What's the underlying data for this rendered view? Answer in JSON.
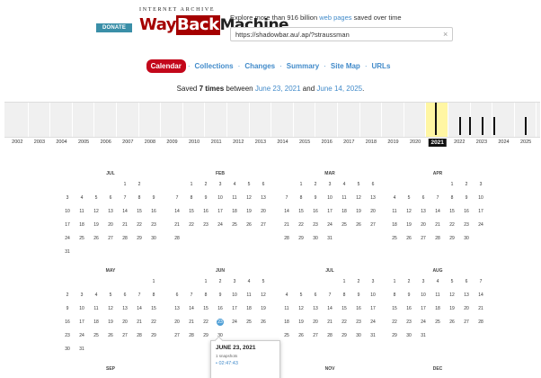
{
  "header": {
    "donate_label": "DONATE",
    "logo_top": "INTERNET ARCHIVE",
    "logo_way": "Way",
    "logo_back": "Back",
    "logo_machine": "Machine",
    "tagline_pre": "Explore more than 916 billion ",
    "tagline_link": "web pages",
    "tagline_post": " saved over time",
    "url_value": "https://shadowbar.au/.ap/?straussman",
    "clear_icon": "close-icon"
  },
  "nav": {
    "calendar": "Calendar",
    "collections": "Collections",
    "changes": "Changes",
    "summary": "Summary",
    "sitemap": "Site Map",
    "urls": "URLs"
  },
  "summary": {
    "pre": "Saved ",
    "count": "7 times",
    "mid": " between ",
    "start": "June 23, 2021",
    "and": " and ",
    "end": "June 14, 2025",
    "post": "."
  },
  "timeline": {
    "selected_year": "2021",
    "years": [
      "2002",
      "2003",
      "2004",
      "2005",
      "2006",
      "2007",
      "2008",
      "2009",
      "2010",
      "2011",
      "2012",
      "2013",
      "2014",
      "2015",
      "2016",
      "2017",
      "2018",
      "2019",
      "2020",
      "2021",
      "2022",
      "2023",
      "2024",
      "2025"
    ]
  },
  "calendar": {
    "months": [
      {
        "name": "JUL",
        "days": [
          "",
          "",
          "",
          "",
          "1",
          "2",
          ""
        ]
      },
      {
        "name": "FEB",
        "days": [
          "",
          "1",
          "2",
          "3",
          "4",
          "5",
          "6"
        ]
      },
      {
        "name": "MAR",
        "days": [
          "",
          "1",
          "2",
          "3",
          "4",
          "5",
          "6"
        ]
      },
      {
        "name": "APR",
        "days": [
          "",
          "",
          "",
          "",
          "1",
          "2",
          "3"
        ]
      },
      {
        "name": "MAY",
        "days": [
          "",
          "",
          "",
          "",
          "",
          "",
          "1"
        ]
      },
      {
        "name": "JUN",
        "days": [
          "",
          "",
          "1",
          "2",
          "3",
          "4",
          "5"
        ]
      },
      {
        "name": "JUL",
        "days": [
          "",
          "",
          "",
          "",
          "1",
          "2",
          "3"
        ]
      },
      {
        "name": "AUG",
        "days": [
          "1",
          "2",
          "3",
          "4",
          "5",
          "6",
          "7"
        ]
      }
    ],
    "rows_q1": [
      [
        [
          "3",
          "4",
          "5",
          "6",
          "7",
          "8",
          "9"
        ],
        [
          "7",
          "8",
          "9",
          "10",
          "11",
          "12",
          "13"
        ],
        [
          "7",
          "8",
          "9",
          "10",
          "11",
          "12",
          "13"
        ],
        [
          "4",
          "5",
          "6",
          "7",
          "8",
          "9",
          "10"
        ]
      ],
      [
        [
          "10",
          "11",
          "12",
          "13",
          "14",
          "15",
          "16"
        ],
        [
          "14",
          "15",
          "16",
          "17",
          "18",
          "19",
          "20"
        ],
        [
          "14",
          "15",
          "16",
          "17",
          "18",
          "19",
          "20"
        ],
        [
          "11",
          "12",
          "13",
          "14",
          "15",
          "16",
          "17"
        ]
      ],
      [
        [
          "17",
          "18",
          "19",
          "20",
          "21",
          "22",
          "23"
        ],
        [
          "21",
          "22",
          "23",
          "24",
          "25",
          "26",
          "27"
        ],
        [
          "21",
          "22",
          "23",
          "24",
          "25",
          "26",
          "27"
        ],
        [
          "18",
          "19",
          "20",
          "21",
          "22",
          "23",
          "24"
        ]
      ],
      [
        [
          "24",
          "25",
          "26",
          "27",
          "28",
          "29",
          "30"
        ],
        [
          "28",
          "",
          "",
          "",
          "",
          "",
          ""
        ],
        [
          "28",
          "29",
          "30",
          "31",
          "",
          "",
          ""
        ],
        [
          "25",
          "26",
          "27",
          "28",
          "29",
          "30",
          ""
        ]
      ],
      [
        [
          "31",
          "",
          "",
          "",
          "",
          "",
          ""
        ],
        [
          "",
          "",
          "",
          "",
          "",
          "",
          ""
        ],
        [
          "",
          "",
          "",
          "",
          "",
          "",
          ""
        ],
        [
          "",
          "",
          "",
          "",
          "",
          "",
          ""
        ]
      ]
    ],
    "rows_q2": [
      [
        [
          "2",
          "3",
          "4",
          "5",
          "6",
          "7",
          "8"
        ],
        [
          "6",
          "7",
          "8",
          "9",
          "10",
          "11",
          "12"
        ],
        [
          "4",
          "5",
          "6",
          "7",
          "8",
          "9",
          "10"
        ],
        [
          "8",
          "9",
          "10",
          "11",
          "12",
          "13",
          "14"
        ]
      ],
      [
        [
          "9",
          "10",
          "11",
          "12",
          "13",
          "14",
          "15"
        ],
        [
          "13",
          "14",
          "15",
          "16",
          "17",
          "18",
          "19"
        ],
        [
          "11",
          "12",
          "13",
          "14",
          "15",
          "16",
          "17"
        ],
        [
          "15",
          "16",
          "17",
          "18",
          "19",
          "20",
          "21"
        ]
      ],
      [
        [
          "16",
          "17",
          "18",
          "19",
          "20",
          "21",
          "22"
        ],
        [
          "20",
          "21",
          "22",
          "23",
          "24",
          "25",
          "26"
        ],
        [
          "18",
          "19",
          "20",
          "21",
          "22",
          "23",
          "24"
        ],
        [
          "22",
          "23",
          "24",
          "25",
          "26",
          "27",
          "28"
        ]
      ],
      [
        [
          "23",
          "24",
          "25",
          "26",
          "27",
          "28",
          "29"
        ],
        [
          "27",
          "28",
          "29",
          "30",
          "",
          "",
          ""
        ],
        [
          "25",
          "26",
          "27",
          "28",
          "29",
          "30",
          "31"
        ],
        [
          "29",
          "30",
          "31",
          "",
          "",
          "",
          ""
        ]
      ],
      [
        [
          "30",
          "31",
          "",
          "",
          "",
          "",
          ""
        ],
        [
          "",
          "",
          "",
          "",
          "",
          "",
          ""
        ],
        [
          "",
          "",
          "",
          "",
          "",
          "",
          ""
        ],
        [
          "",
          "",
          "",
          "",
          "",
          "",
          ""
        ]
      ]
    ],
    "months_q3": [
      "SEP",
      "OCT",
      "NOV",
      "DEC"
    ],
    "captured_day": "23"
  },
  "popup": {
    "date": "JUNE 23, 2021",
    "count": "1 snapshots",
    "time": "02:47:43"
  },
  "colors": {
    "accent": "#c3071b",
    "link": "#428bca",
    "highlight": "#fff6a3"
  }
}
